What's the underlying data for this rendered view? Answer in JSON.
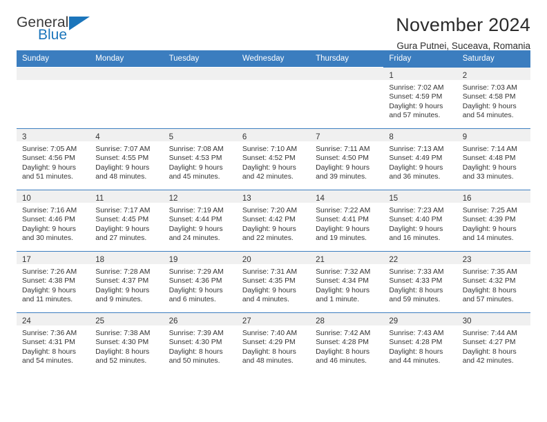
{
  "brand": {
    "name_part1": "General",
    "name_part2": "Blue",
    "accent_color": "#1b75bb"
  },
  "header": {
    "title": "November 2024",
    "subtitle": "Gura Putnei, Suceava, Romania"
  },
  "theme": {
    "header_row_color": "#3b7dbf",
    "daynum_band_color": "#f0f0f0",
    "cell_top_border_color": "#3b7dbf"
  },
  "weekday_headers": [
    "Sunday",
    "Monday",
    "Tuesday",
    "Wednesday",
    "Thursday",
    "Friday",
    "Saturday"
  ],
  "labels": {
    "sunrise_prefix": "Sunrise:",
    "sunset_prefix": "Sunset:",
    "daylight_prefix": "Daylight:"
  },
  "weeks": [
    [
      {
        "empty": true
      },
      {
        "empty": true
      },
      {
        "empty": true
      },
      {
        "empty": true
      },
      {
        "empty": true
      },
      {
        "day": "1",
        "sunrise": "Sunrise: 7:02 AM",
        "sunset": "Sunset: 4:59 PM",
        "daylight_1": "Daylight: 9 hours",
        "daylight_2": "and 57 minutes."
      },
      {
        "day": "2",
        "sunrise": "Sunrise: 7:03 AM",
        "sunset": "Sunset: 4:58 PM",
        "daylight_1": "Daylight: 9 hours",
        "daylight_2": "and 54 minutes."
      }
    ],
    [
      {
        "day": "3",
        "sunrise": "Sunrise: 7:05 AM",
        "sunset": "Sunset: 4:56 PM",
        "daylight_1": "Daylight: 9 hours",
        "daylight_2": "and 51 minutes."
      },
      {
        "day": "4",
        "sunrise": "Sunrise: 7:07 AM",
        "sunset": "Sunset: 4:55 PM",
        "daylight_1": "Daylight: 9 hours",
        "daylight_2": "and 48 minutes."
      },
      {
        "day": "5",
        "sunrise": "Sunrise: 7:08 AM",
        "sunset": "Sunset: 4:53 PM",
        "daylight_1": "Daylight: 9 hours",
        "daylight_2": "and 45 minutes."
      },
      {
        "day": "6",
        "sunrise": "Sunrise: 7:10 AM",
        "sunset": "Sunset: 4:52 PM",
        "daylight_1": "Daylight: 9 hours",
        "daylight_2": "and 42 minutes."
      },
      {
        "day": "7",
        "sunrise": "Sunrise: 7:11 AM",
        "sunset": "Sunset: 4:50 PM",
        "daylight_1": "Daylight: 9 hours",
        "daylight_2": "and 39 minutes."
      },
      {
        "day": "8",
        "sunrise": "Sunrise: 7:13 AM",
        "sunset": "Sunset: 4:49 PM",
        "daylight_1": "Daylight: 9 hours",
        "daylight_2": "and 36 minutes."
      },
      {
        "day": "9",
        "sunrise": "Sunrise: 7:14 AM",
        "sunset": "Sunset: 4:48 PM",
        "daylight_1": "Daylight: 9 hours",
        "daylight_2": "and 33 minutes."
      }
    ],
    [
      {
        "day": "10",
        "sunrise": "Sunrise: 7:16 AM",
        "sunset": "Sunset: 4:46 PM",
        "daylight_1": "Daylight: 9 hours",
        "daylight_2": "and 30 minutes."
      },
      {
        "day": "11",
        "sunrise": "Sunrise: 7:17 AM",
        "sunset": "Sunset: 4:45 PM",
        "daylight_1": "Daylight: 9 hours",
        "daylight_2": "and 27 minutes."
      },
      {
        "day": "12",
        "sunrise": "Sunrise: 7:19 AM",
        "sunset": "Sunset: 4:44 PM",
        "daylight_1": "Daylight: 9 hours",
        "daylight_2": "and 24 minutes."
      },
      {
        "day": "13",
        "sunrise": "Sunrise: 7:20 AM",
        "sunset": "Sunset: 4:42 PM",
        "daylight_1": "Daylight: 9 hours",
        "daylight_2": "and 22 minutes."
      },
      {
        "day": "14",
        "sunrise": "Sunrise: 7:22 AM",
        "sunset": "Sunset: 4:41 PM",
        "daylight_1": "Daylight: 9 hours",
        "daylight_2": "and 19 minutes."
      },
      {
        "day": "15",
        "sunrise": "Sunrise: 7:23 AM",
        "sunset": "Sunset: 4:40 PM",
        "daylight_1": "Daylight: 9 hours",
        "daylight_2": "and 16 minutes."
      },
      {
        "day": "16",
        "sunrise": "Sunrise: 7:25 AM",
        "sunset": "Sunset: 4:39 PM",
        "daylight_1": "Daylight: 9 hours",
        "daylight_2": "and 14 minutes."
      }
    ],
    [
      {
        "day": "17",
        "sunrise": "Sunrise: 7:26 AM",
        "sunset": "Sunset: 4:38 PM",
        "daylight_1": "Daylight: 9 hours",
        "daylight_2": "and 11 minutes."
      },
      {
        "day": "18",
        "sunrise": "Sunrise: 7:28 AM",
        "sunset": "Sunset: 4:37 PM",
        "daylight_1": "Daylight: 9 hours",
        "daylight_2": "and 9 minutes."
      },
      {
        "day": "19",
        "sunrise": "Sunrise: 7:29 AM",
        "sunset": "Sunset: 4:36 PM",
        "daylight_1": "Daylight: 9 hours",
        "daylight_2": "and 6 minutes."
      },
      {
        "day": "20",
        "sunrise": "Sunrise: 7:31 AM",
        "sunset": "Sunset: 4:35 PM",
        "daylight_1": "Daylight: 9 hours",
        "daylight_2": "and 4 minutes."
      },
      {
        "day": "21",
        "sunrise": "Sunrise: 7:32 AM",
        "sunset": "Sunset: 4:34 PM",
        "daylight_1": "Daylight: 9 hours",
        "daylight_2": "and 1 minute."
      },
      {
        "day": "22",
        "sunrise": "Sunrise: 7:33 AM",
        "sunset": "Sunset: 4:33 PM",
        "daylight_1": "Daylight: 8 hours",
        "daylight_2": "and 59 minutes."
      },
      {
        "day": "23",
        "sunrise": "Sunrise: 7:35 AM",
        "sunset": "Sunset: 4:32 PM",
        "daylight_1": "Daylight: 8 hours",
        "daylight_2": "and 57 minutes."
      }
    ],
    [
      {
        "day": "24",
        "sunrise": "Sunrise: 7:36 AM",
        "sunset": "Sunset: 4:31 PM",
        "daylight_1": "Daylight: 8 hours",
        "daylight_2": "and 54 minutes."
      },
      {
        "day": "25",
        "sunrise": "Sunrise: 7:38 AM",
        "sunset": "Sunset: 4:30 PM",
        "daylight_1": "Daylight: 8 hours",
        "daylight_2": "and 52 minutes."
      },
      {
        "day": "26",
        "sunrise": "Sunrise: 7:39 AM",
        "sunset": "Sunset: 4:30 PM",
        "daylight_1": "Daylight: 8 hours",
        "daylight_2": "and 50 minutes."
      },
      {
        "day": "27",
        "sunrise": "Sunrise: 7:40 AM",
        "sunset": "Sunset: 4:29 PM",
        "daylight_1": "Daylight: 8 hours",
        "daylight_2": "and 48 minutes."
      },
      {
        "day": "28",
        "sunrise": "Sunrise: 7:42 AM",
        "sunset": "Sunset: 4:28 PM",
        "daylight_1": "Daylight: 8 hours",
        "daylight_2": "and 46 minutes."
      },
      {
        "day": "29",
        "sunrise": "Sunrise: 7:43 AM",
        "sunset": "Sunset: 4:28 PM",
        "daylight_1": "Daylight: 8 hours",
        "daylight_2": "and 44 minutes."
      },
      {
        "day": "30",
        "sunrise": "Sunrise: 7:44 AM",
        "sunset": "Sunset: 4:27 PM",
        "daylight_1": "Daylight: 8 hours",
        "daylight_2": "and 42 minutes."
      }
    ]
  ]
}
